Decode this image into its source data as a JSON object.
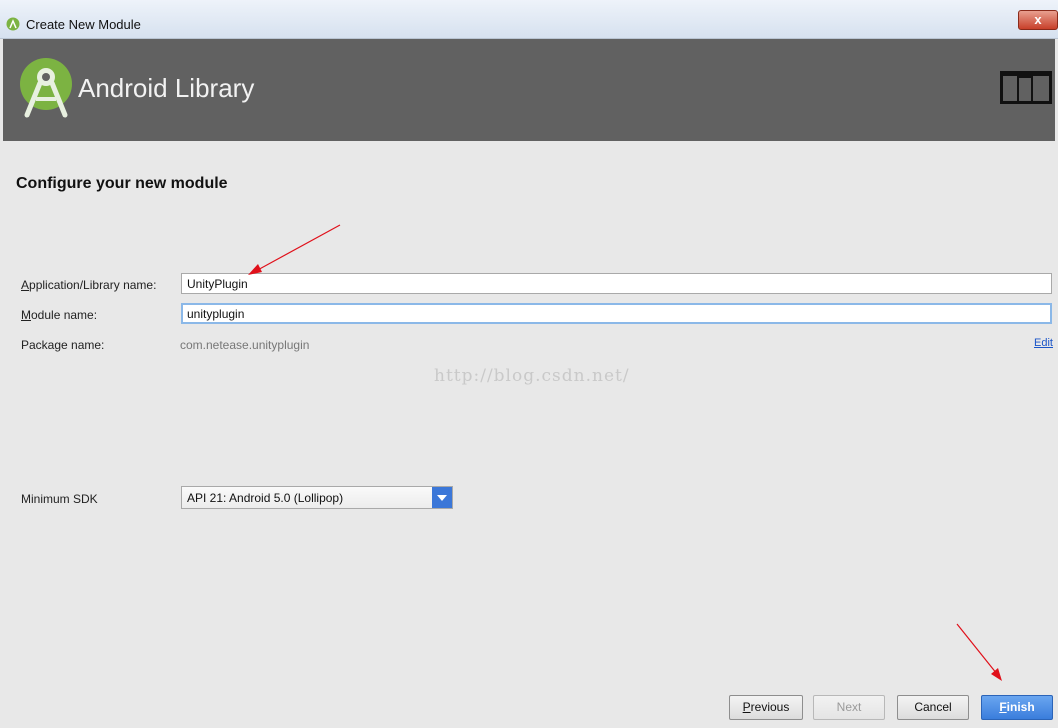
{
  "window": {
    "title": "Create New Module",
    "close_label": "x"
  },
  "banner": {
    "heading": "Android Library"
  },
  "form": {
    "section_title": "Configure your new module",
    "app_name": {
      "label_first": "A",
      "label_rest": "pplication/Library name:",
      "value": "UnityPlugin"
    },
    "module_name": {
      "label_first": "M",
      "label_rest": "odule name:",
      "value": "unityplugin"
    },
    "package_name": {
      "label": "Package name:",
      "value": "com.netease.unityplugin",
      "edit_label": "Edit"
    },
    "min_sdk": {
      "label": "Minimum SDK",
      "selected": "API 21: Android 5.0 (Lollipop)"
    },
    "watermark": "http://blog.csdn.net/"
  },
  "buttons": {
    "previous_first": "P",
    "previous_rest": "revious",
    "next": "Next",
    "cancel": "Cancel",
    "finish_first": "F",
    "finish_rest": "inish"
  },
  "colors": {
    "banner": "#616161",
    "accent": "#3b77d8",
    "annotation": "#e0101a"
  }
}
